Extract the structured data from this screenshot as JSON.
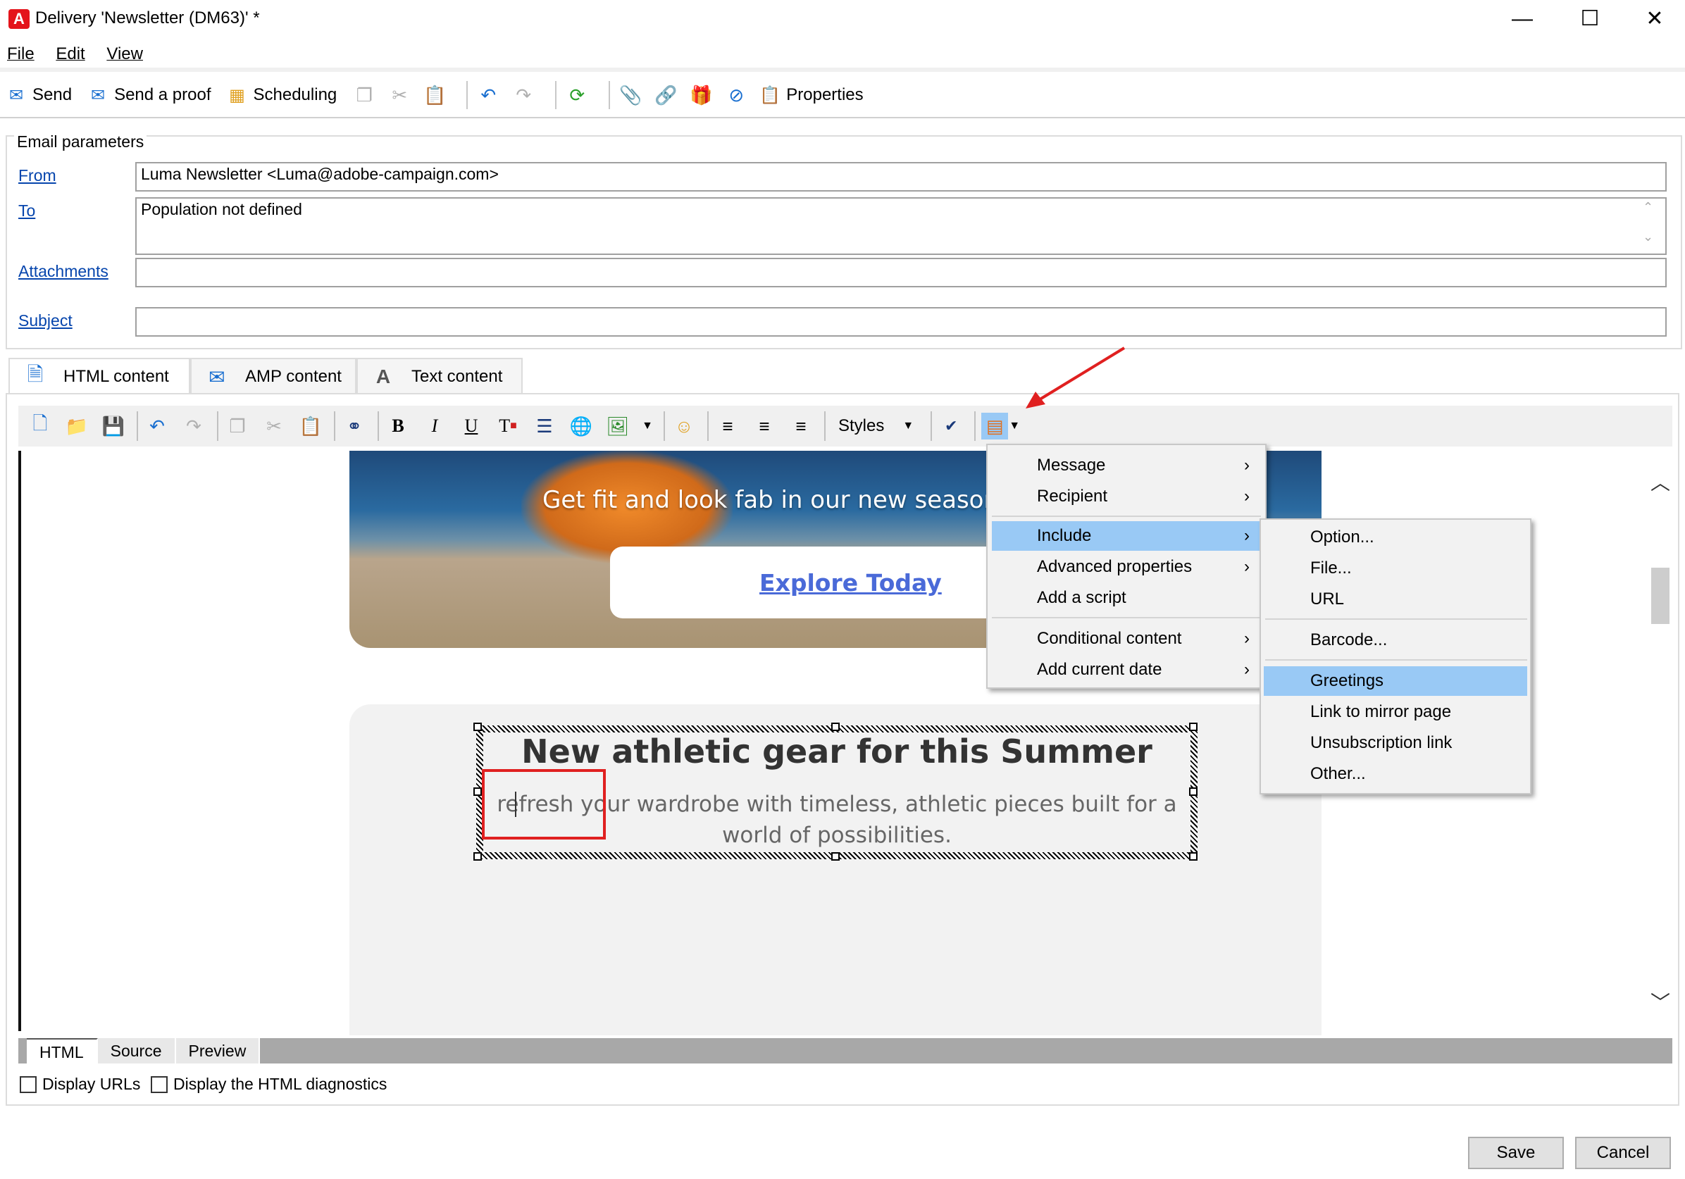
{
  "window": {
    "app_icon": "adobe-campaign-icon",
    "title": "Delivery 'Newsletter (DM63)' *",
    "minimize": "—",
    "maximize": "☐",
    "close": "✕"
  },
  "menubar": {
    "items": [
      "File",
      "Edit",
      "View"
    ]
  },
  "toolbar": {
    "send": "Send",
    "send_proof": "Send a proof",
    "scheduling": "Scheduling",
    "properties": "Properties"
  },
  "email_params": {
    "legend": "Email parameters",
    "from_label": "From",
    "from_value": "Luma Newsletter <Luma@adobe-campaign.com>",
    "to_label": "To",
    "to_value": "Population not defined",
    "attachments_label": "Attachments",
    "attachments_value": "",
    "subject_label": "Subject",
    "subject_value": ""
  },
  "tabs": [
    {
      "label": "HTML content",
      "icon": "html-content-icon"
    },
    {
      "label": "AMP content",
      "icon": "amp-content-icon"
    },
    {
      "label": "Text content",
      "icon": "text-content-icon"
    }
  ],
  "editor_toolbar": {
    "styles_label": "Styles"
  },
  "editor": {
    "hero_subtitle": "Get fit and look fab in our new seasona",
    "hero_link": "Explore Today",
    "card_heading": "New athletic gear for this Summer",
    "card_body": "refresh your wardrobe with timeless, athletic pieces built for a world of possibilities."
  },
  "context_menu": {
    "items": [
      {
        "label": "Message",
        "submenu": true
      },
      {
        "label": "Recipient",
        "submenu": true
      },
      {
        "label": "Include",
        "submenu": true,
        "highlighted": true
      },
      {
        "label": "Advanced properties",
        "submenu": true
      },
      {
        "label": "Add a script",
        "submenu": false
      },
      {
        "label": "Conditional content",
        "submenu": true
      },
      {
        "label": "Add current date",
        "submenu": true
      }
    ],
    "submenu_arrow": "›"
  },
  "include_submenu": {
    "items": [
      {
        "label": "Option..."
      },
      {
        "label": "File..."
      },
      {
        "label": "URL"
      },
      {
        "label": "Barcode..."
      },
      {
        "label": "Greetings",
        "highlighted": true
      },
      {
        "label": "Link to mirror page"
      },
      {
        "label": "Unsubscription link"
      },
      {
        "label": "Other..."
      }
    ]
  },
  "bottom_tabs": [
    "HTML",
    "Source",
    "Preview"
  ],
  "options": {
    "display_urls": "Display URLs",
    "display_html_diagnostics": "Display the HTML diagnostics"
  },
  "dialog": {
    "save": "Save",
    "cancel": "Cancel"
  },
  "colors": {
    "menu_highlight": "#99c9f5",
    "annotation_red": "#e02020",
    "link_blue": "#0645ad"
  }
}
